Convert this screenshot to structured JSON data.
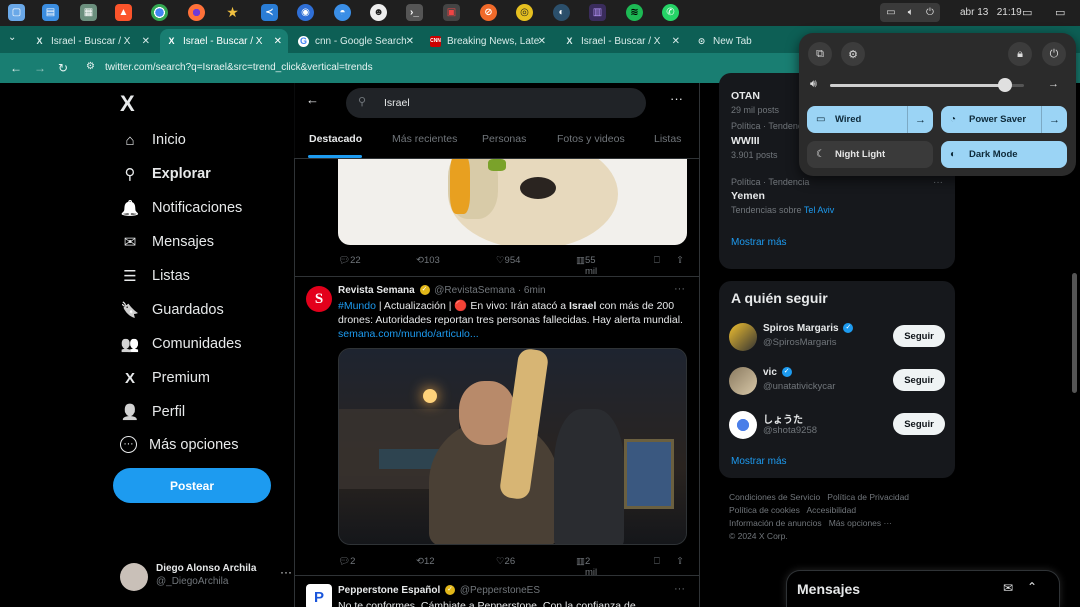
{
  "taskbar": {
    "apps": [
      "app-1",
      "app-2",
      "app-3",
      "brave",
      "chrome",
      "firefox",
      "app-7",
      "vscode",
      "app-9",
      "app-10",
      "app-11",
      "terminal",
      "app-13",
      "app-14",
      "app-15",
      "app-16",
      "app-17",
      "spotify",
      "whatsapp"
    ],
    "date": "abr 13",
    "time": "21:19"
  },
  "browser": {
    "tabs": [
      {
        "label": "Israel - Buscar / X",
        "favicon": "X"
      },
      {
        "label": "Israel - Buscar / X",
        "favicon": "X"
      },
      {
        "label": "cnn - Google Search",
        "favicon": "G"
      },
      {
        "label": "Breaking News, Late",
        "favicon": "CNN"
      },
      {
        "label": "Israel - Buscar / X",
        "favicon": "X"
      },
      {
        "label": "New Tab",
        "favicon": "⊙"
      }
    ],
    "url": "twitter.com/search?q=Israel&src=trend_click&vertical=trends"
  },
  "sidebar": {
    "logo": "X",
    "items": [
      {
        "label": "Inicio",
        "icon": "⌂"
      },
      {
        "label": "Explorar",
        "icon": "⚲"
      },
      {
        "label": "Notificaciones",
        "icon": "🔔"
      },
      {
        "label": "Mensajes",
        "icon": "✉"
      },
      {
        "label": "Listas",
        "icon": "☰"
      },
      {
        "label": "Guardados",
        "icon": "🔖"
      },
      {
        "label": "Comunidades",
        "icon": "👥"
      },
      {
        "label": "Premium",
        "icon": "X"
      },
      {
        "label": "Perfil",
        "icon": "👤"
      },
      {
        "label": "Más opciones",
        "icon": "⋯"
      }
    ],
    "post_label": "Postear",
    "user": {
      "name": "Diego Alonso Archila",
      "handle": "@_DiegoArchila"
    }
  },
  "feed": {
    "search_value": "Israel",
    "tabs": [
      "Destacado",
      "Más recientes",
      "Personas",
      "Fotos y videos",
      "Listas"
    ],
    "tweet1_stats": {
      "replies": "22",
      "reposts": "103",
      "likes": "954",
      "views": "55 mil"
    },
    "tweet2": {
      "name": "Revista Semana",
      "handle": "@RevistaSemana",
      "time": "· 6min",
      "hashtag": "#Mundo",
      "text_a": " | Actualización | 🔴 En vivo: Irán atacó a ",
      "text_bold": "Israel",
      "text_b": " con más de 200 drones: Autoridades reportan tres personas fallecidas. Hay alerta mundial.",
      "link": "semana.com/mundo/articulo...",
      "stats": {
        "replies": "2",
        "reposts": "12",
        "likes": "26",
        "views": "2 mil"
      }
    },
    "tweet3": {
      "name": "Pepperstone Español",
      "handle": "@PepperstoneES",
      "text": "No te conformes. Cámbiate a Pepperstone. Con la confianza de"
    }
  },
  "trends": {
    "items": [
      {
        "meta": "",
        "title": "OTAN",
        "sub": "29 mil posts"
      },
      {
        "meta": "Política · Tendencia",
        "title": "WWIII",
        "sub": "3.901 posts"
      },
      {
        "meta": "Política · Tendencia",
        "title": "Yemen",
        "sub_prefix": "Tendencias sobre ",
        "sub_link": "Tel Aviv"
      }
    ],
    "show_more": "Mostrar más"
  },
  "who_to_follow": {
    "title": "A quién seguir",
    "users": [
      {
        "name": "Spiros Margaris",
        "handle": "@SpirosMargaris",
        "verified": true
      },
      {
        "name": "vic",
        "handle": "@unatativickycar",
        "verified": true
      },
      {
        "name": "しょうた",
        "handle": "@shota9258",
        "verified": false
      }
    ],
    "follow_label": "Seguir",
    "show_more": "Mostrar más"
  },
  "footer": {
    "links": [
      "Condiciones de Servicio",
      "Política de Privacidad",
      "Política de cookies",
      "Accesibilidad",
      "Información de anuncios",
      "Más opciones ···",
      "© 2024 X Corp."
    ]
  },
  "messages_drawer": {
    "title": "Mensajes"
  },
  "quick_settings": {
    "volume_level": 0.9,
    "buttons": [
      {
        "label": "Wired",
        "state": "on",
        "icon": "monitor-icon",
        "has_arrow": true
      },
      {
        "label": "Power Saver",
        "state": "on",
        "icon": "power-saver-icon",
        "has_arrow": true
      },
      {
        "label": "Night Light",
        "state": "off",
        "icon": "moon-icon",
        "has_arrow": false
      },
      {
        "label": "Dark Mode",
        "state": "on",
        "icon": "dark-mode-icon",
        "has_arrow": false
      }
    ]
  },
  "colors": {
    "accent": "#1d9bf0",
    "tab_bar": "#0d5f55",
    "address_bar": "#197e72"
  }
}
